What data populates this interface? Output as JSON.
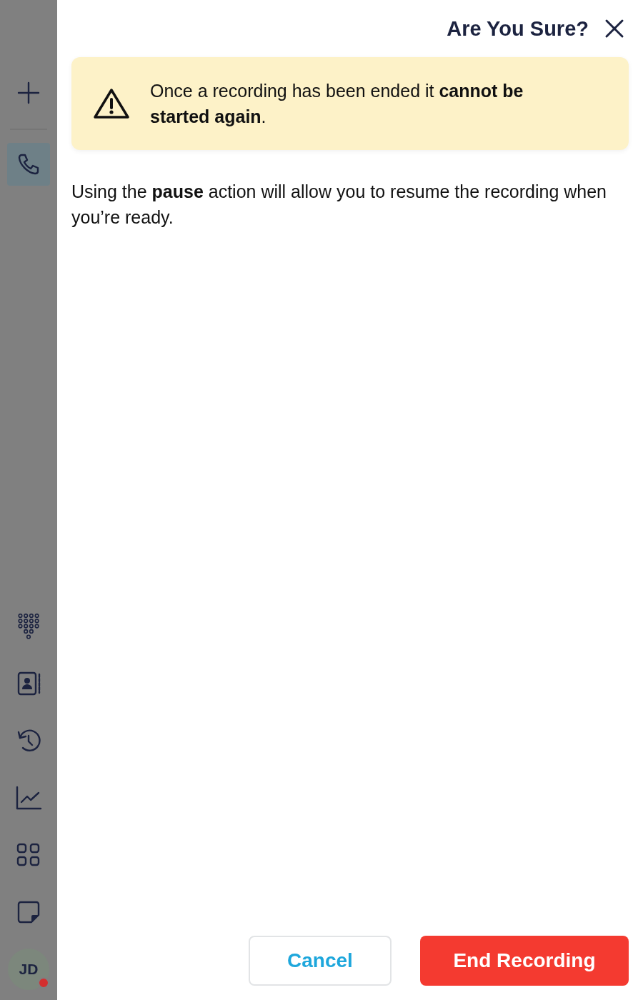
{
  "sidebar": {
    "top_items": [
      {
        "kind": "add",
        "selected": false
      },
      {
        "kind": "phone",
        "selected": true
      }
    ],
    "bottom_items": [
      {
        "kind": "keypad",
        "selected": false
      },
      {
        "kind": "contacts",
        "selected": false
      },
      {
        "kind": "history",
        "selected": false
      },
      {
        "kind": "analytics",
        "selected": false
      },
      {
        "kind": "apps",
        "selected": false
      },
      {
        "kind": "notes",
        "selected": false
      }
    ],
    "avatar": {
      "initials": "JD",
      "color": "#d32f2f"
    }
  },
  "dialog": {
    "title": "Are You Sure?",
    "warning": "Once a recording has been ended it **cannot be started again**.",
    "message": "Using the **pause** action will allow you to resume the recording when you’re ready.",
    "buttons": [
      {
        "kind": "secondary",
        "label": "Cancel"
      },
      {
        "kind": "danger",
        "label": "End Recording"
      }
    ]
  }
}
